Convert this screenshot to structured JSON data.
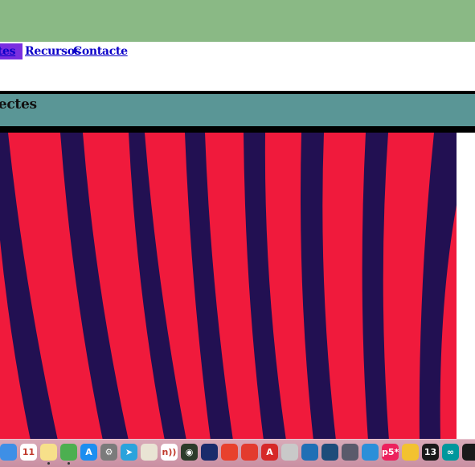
{
  "nav": {
    "links": [
      "ectes",
      "Recursos",
      "Contacte"
    ]
  },
  "section": {
    "title": "jectes"
  },
  "colors": {
    "banner": "#8ab985",
    "section": "#5a9696",
    "hero_red": "#f01a3c",
    "hero_stripe": "#221052",
    "link": "#0b00c8",
    "active_link_bg": "#7a2fe0"
  },
  "dock": {
    "icons": [
      {
        "name": "finder-icon",
        "label": "",
        "color": "#3e8fe6"
      },
      {
        "name": "calendar-icon",
        "label": "11",
        "color": "#ffffff"
      },
      {
        "name": "notes-icon",
        "label": "",
        "color": "#f7e08a"
      },
      {
        "name": "chrome-icon",
        "label": "",
        "color": "#4caf50"
      },
      {
        "name": "app-store-icon",
        "label": "A",
        "color": "#1c8ef0"
      },
      {
        "name": "system-preferences-icon",
        "label": "⚙",
        "color": "#7b7b7b"
      },
      {
        "name": "telegram-icon",
        "label": "➤",
        "color": "#2aa3dc"
      },
      {
        "name": "textedit-icon",
        "label": "",
        "color": "#e9e4d4"
      },
      {
        "name": "nfc-tools-icon",
        "label": "n))",
        "color": "#ffffff"
      },
      {
        "name": "camera-app-icon",
        "label": "◉",
        "color": "#2c3b2a"
      },
      {
        "name": "pen-tool-icon",
        "label": "",
        "color": "#1a2b6b"
      },
      {
        "name": "slides-app-icon",
        "label": "",
        "color": "#e8412d"
      },
      {
        "name": "snippet-icon",
        "label": "",
        "color": "#e33b2e"
      },
      {
        "name": "font-app-icon",
        "label": "A",
        "color": "#d62828"
      },
      {
        "name": "preview-icon",
        "label": "",
        "color": "#c9c9c9"
      },
      {
        "name": "globe-app-icon",
        "label": "",
        "color": "#1f6fb5"
      },
      {
        "name": "layout-app-icon",
        "label": "",
        "color": "#1d4c7a"
      },
      {
        "name": "davinci-icon",
        "label": "",
        "color": "#5a5a6b"
      },
      {
        "name": "vscode-icon",
        "label": "",
        "color": "#2b8fd9"
      },
      {
        "name": "p5-icon",
        "label": "p5*",
        "color": "#ed225d"
      },
      {
        "name": "cyberduck-icon",
        "label": "",
        "color": "#f2c230"
      },
      {
        "name": "thirteen-icon",
        "label": "13",
        "color": "#1a1a1a"
      },
      {
        "name": "arduino-icon",
        "label": "∞",
        "color": "#00979c"
      },
      {
        "name": "acrobat-icon",
        "label": "",
        "color": "#1a1a1a"
      }
    ]
  }
}
